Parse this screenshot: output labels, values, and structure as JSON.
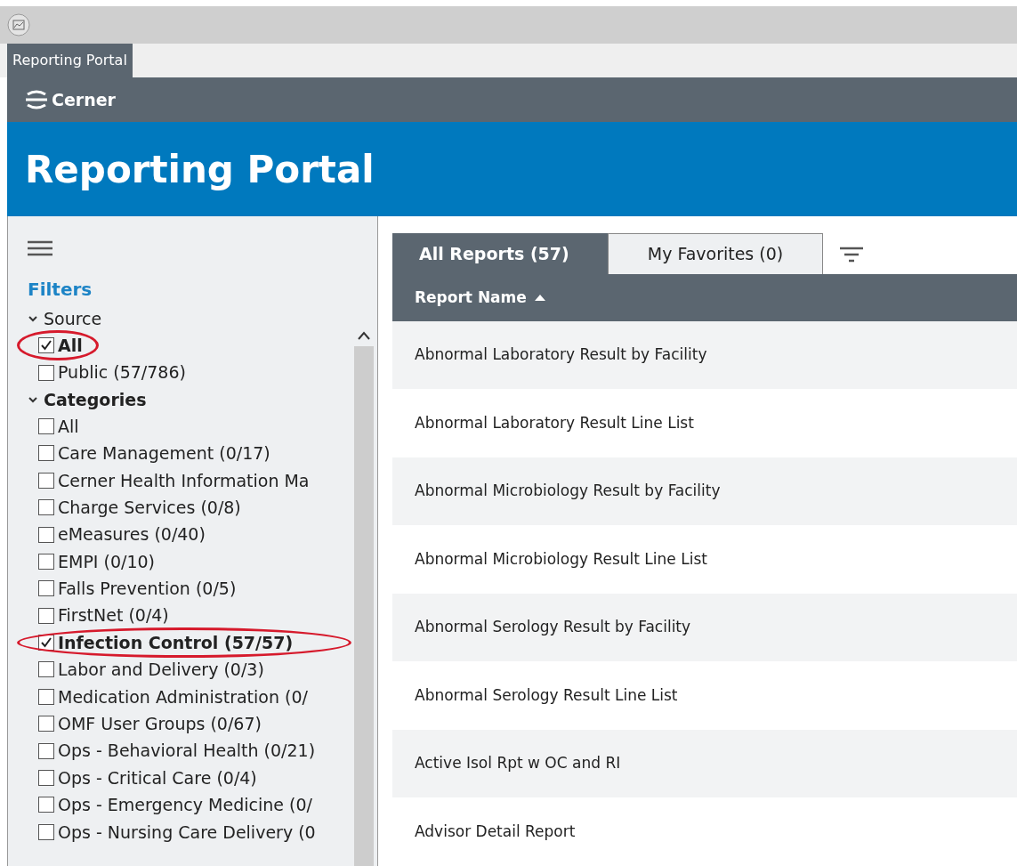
{
  "window": {
    "tab": "Reporting Portal"
  },
  "header": {
    "logo_text": "Cerner",
    "title": "Reporting Portal"
  },
  "filters": {
    "title": "Filters",
    "groups": [
      {
        "label": "Source",
        "expanded": true,
        "bold": false,
        "items": [
          {
            "label": "All",
            "checked": true,
            "circled": true
          },
          {
            "label": "Public (57/786)",
            "checked": false,
            "circled": false
          }
        ]
      },
      {
        "label": "Categories",
        "expanded": true,
        "bold": true,
        "items": [
          {
            "label": "All",
            "checked": false,
            "circled": false
          },
          {
            "label": "Care Management (0/17)",
            "checked": false,
            "circled": false
          },
          {
            "label": "Cerner Health Information Ma",
            "checked": false,
            "circled": false
          },
          {
            "label": "Charge Services (0/8)",
            "checked": false,
            "circled": false
          },
          {
            "label": "eMeasures (0/40)",
            "checked": false,
            "circled": false
          },
          {
            "label": "EMPI (0/10)",
            "checked": false,
            "circled": false
          },
          {
            "label": "Falls Prevention (0/5)",
            "checked": false,
            "circled": false
          },
          {
            "label": "FirstNet (0/4)",
            "checked": false,
            "circled": false
          },
          {
            "label": "Infection Control (57/57)",
            "checked": true,
            "circled": true
          },
          {
            "label": "Labor and Delivery (0/3)",
            "checked": false,
            "circled": false
          },
          {
            "label": "Medication Administration (0/",
            "checked": false,
            "circled": false
          },
          {
            "label": "OMF User Groups (0/67)",
            "checked": false,
            "circled": false
          },
          {
            "label": "Ops - Behavioral Health (0/21)",
            "checked": false,
            "circled": false
          },
          {
            "label": "Ops - Critical Care (0/4)",
            "checked": false,
            "circled": false
          },
          {
            "label": "Ops - Emergency Medicine (0/",
            "checked": false,
            "circled": false
          },
          {
            "label": "Ops - Nursing Care Delivery (0",
            "checked": false,
            "circled": false
          }
        ]
      }
    ]
  },
  "tabs": [
    {
      "label": "All Reports (57)",
      "selected": true
    },
    {
      "label": "My Favorites (0)",
      "selected": false
    }
  ],
  "table": {
    "columns": [
      "Report Name"
    ],
    "rows": [
      "Abnormal Laboratory Result by Facility",
      "Abnormal Laboratory Result Line List",
      "Abnormal Microbiology Result by Facility",
      "Abnormal Microbiology Result Line List",
      "Abnormal Serology Result by Facility",
      "Abnormal Serology Result Line List",
      "Active Isol Rpt w OC and RI",
      "Advisor Detail Report"
    ]
  }
}
